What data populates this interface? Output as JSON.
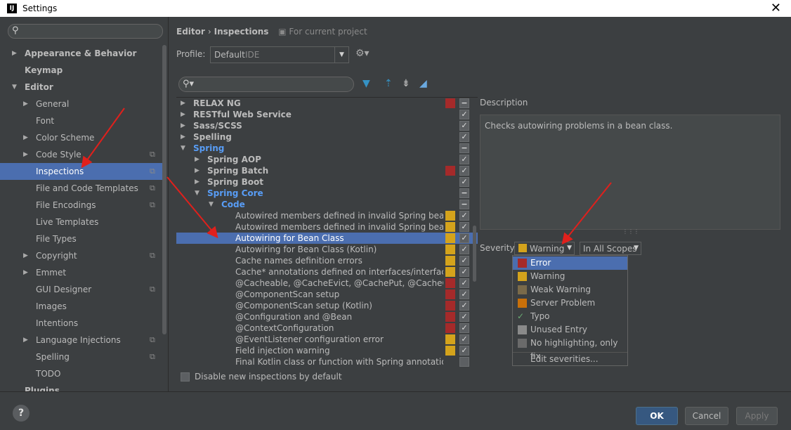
{
  "window": {
    "title": "Settings",
    "logo": "IJ"
  },
  "left_tree": {
    "search_placeholder": "",
    "items": [
      {
        "label": "Appearance & Behavior",
        "bold": true,
        "arrow": "▶",
        "indent": 0
      },
      {
        "label": "Keymap",
        "bold": true,
        "arrow": "",
        "indent": 0
      },
      {
        "label": "Editor",
        "bold": true,
        "arrow": "▼",
        "indent": 0
      },
      {
        "label": "General",
        "arrow": "▶",
        "indent": 1
      },
      {
        "label": "Font",
        "arrow": "",
        "indent": 1
      },
      {
        "label": "Color Scheme",
        "arrow": "▶",
        "indent": 1
      },
      {
        "label": "Code Style",
        "arrow": "▶",
        "indent": 1,
        "copy": true
      },
      {
        "label": "Inspections",
        "arrow": "",
        "indent": 1,
        "copy": true,
        "selected": true
      },
      {
        "label": "File and Code Templates",
        "arrow": "",
        "indent": 1,
        "copy": true
      },
      {
        "label": "File Encodings",
        "arrow": "",
        "indent": 1,
        "copy": true
      },
      {
        "label": "Live Templates",
        "arrow": "",
        "indent": 1
      },
      {
        "label": "File Types",
        "arrow": "",
        "indent": 1
      },
      {
        "label": "Copyright",
        "arrow": "▶",
        "indent": 1,
        "copy": true
      },
      {
        "label": "Emmet",
        "arrow": "▶",
        "indent": 1
      },
      {
        "label": "GUI Designer",
        "arrow": "",
        "indent": 1,
        "copy": true
      },
      {
        "label": "Images",
        "arrow": "",
        "indent": 1
      },
      {
        "label": "Intentions",
        "arrow": "",
        "indent": 1
      },
      {
        "label": "Language Injections",
        "arrow": "▶",
        "indent": 1,
        "copy": true
      },
      {
        "label": "Spelling",
        "arrow": "",
        "indent": 1,
        "copy": true
      },
      {
        "label": "TODO",
        "arrow": "",
        "indent": 1
      },
      {
        "label": "Plugins",
        "bold": true,
        "arrow": "",
        "indent": 0
      }
    ]
  },
  "breadcrumb": {
    "part1": "Editor",
    "separator": "›",
    "part2": "Inspections",
    "scope_note": "For current project"
  },
  "profile": {
    "label": "Profile:",
    "value": "Default",
    "value_suffix": "IDE"
  },
  "inspections": {
    "rows": [
      {
        "label": "RELAX NG",
        "style": "bold",
        "arrow": "▶",
        "indent": 0,
        "sev": "#a52a2a",
        "check": "dash"
      },
      {
        "label": "RESTful Web Service",
        "style": "bold",
        "arrow": "▶",
        "indent": 0,
        "sev": "",
        "check": "yes"
      },
      {
        "label": "Sass/SCSS",
        "style": "bold",
        "arrow": "▶",
        "indent": 0,
        "sev": "",
        "check": "yes"
      },
      {
        "label": "Spelling",
        "style": "bold",
        "arrow": "▶",
        "indent": 0,
        "sev": "",
        "check": "yes"
      },
      {
        "label": "Spring",
        "style": "blue",
        "arrow": "▼",
        "indent": 0,
        "sev": "",
        "check": "dash"
      },
      {
        "label": "Spring AOP",
        "style": "bold",
        "arrow": "▶",
        "indent": 1,
        "sev": "",
        "check": "yes"
      },
      {
        "label": "Spring Batch",
        "style": "bold",
        "arrow": "▶",
        "indent": 1,
        "sev": "#a52a2a",
        "check": "yes"
      },
      {
        "label": "Spring Boot",
        "style": "bold",
        "arrow": "▶",
        "indent": 1,
        "sev": "",
        "check": "yes"
      },
      {
        "label": "Spring Core",
        "style": "blue",
        "arrow": "▼",
        "indent": 1,
        "sev": "",
        "check": "dash"
      },
      {
        "label": "Code",
        "style": "blue",
        "arrow": "▼",
        "indent": 2,
        "sev": "",
        "check": "dash"
      },
      {
        "label": "Autowired members defined in invalid Spring bean",
        "style": "",
        "arrow": "",
        "indent": 3,
        "sev": "#d4a31c",
        "check": "yes"
      },
      {
        "label": "Autowired members defined in invalid Spring bean (Kotlin)",
        "style": "",
        "arrow": "",
        "indent": 3,
        "sev": "#d4a31c",
        "check": "yes"
      },
      {
        "label": "Autowiring for Bean Class",
        "style": "",
        "arrow": "",
        "indent": 3,
        "sev": "#d4a31c",
        "check": "yes",
        "selected": true
      },
      {
        "label": "Autowiring for Bean Class (Kotlin)",
        "style": "",
        "arrow": "",
        "indent": 3,
        "sev": "#d4a31c",
        "check": "yes"
      },
      {
        "label": "Cache names definition errors",
        "style": "",
        "arrow": "",
        "indent": 3,
        "sev": "#d4a31c",
        "check": "yes"
      },
      {
        "label": "Cache* annotations defined on interfaces/interface methods",
        "style": "",
        "arrow": "",
        "indent": 3,
        "sev": "#d4a31c",
        "check": "yes"
      },
      {
        "label": "@Cacheable, @CacheEvict, @CachePut, @CacheConfig",
        "style": "",
        "arrow": "",
        "indent": 3,
        "sev": "#a52a2a",
        "check": "yes"
      },
      {
        "label": "@ComponentScan setup",
        "style": "",
        "arrow": "",
        "indent": 3,
        "sev": "#a52a2a",
        "check": "yes"
      },
      {
        "label": "@ComponentScan setup (Kotlin)",
        "style": "",
        "arrow": "",
        "indent": 3,
        "sev": "#a52a2a",
        "check": "yes"
      },
      {
        "label": "@Configuration and @Bean",
        "style": "",
        "arrow": "",
        "indent": 3,
        "sev": "#a52a2a",
        "check": "yes"
      },
      {
        "label": "@ContextConfiguration",
        "style": "",
        "arrow": "",
        "indent": 3,
        "sev": "#a52a2a",
        "check": "yes"
      },
      {
        "label": "@EventListener configuration error",
        "style": "",
        "arrow": "",
        "indent": 3,
        "sev": "#d4a31c",
        "check": "yes"
      },
      {
        "label": "Field injection warning",
        "style": "",
        "arrow": "",
        "indent": 3,
        "sev": "#d4a31c",
        "check": "yes"
      },
      {
        "label": "Final Kotlin class or function with Spring annotation",
        "style": "",
        "arrow": "",
        "indent": 3,
        "sev": "",
        "check": "partial"
      }
    ]
  },
  "description": {
    "label": "Description",
    "text": "Checks autowiring problems in a bean class."
  },
  "severity": {
    "label": "Severity:",
    "value": "Warning",
    "scope": "In All Scopes",
    "options": [
      {
        "label": "Error",
        "color": "#a52a2a",
        "selected": true
      },
      {
        "label": "Warning",
        "color": "#d4a31c"
      },
      {
        "label": "Weak Warning",
        "color": "#7a6a4a"
      },
      {
        "label": "Server Problem",
        "color": "#c8700a"
      },
      {
        "label": "Typo",
        "color": "",
        "tick": "✓"
      },
      {
        "label": "Unused Entry",
        "color": "#8a8a8a"
      },
      {
        "label": "No highlighting, only fix",
        "color": "#6a6a6a"
      }
    ],
    "edit_label": "Edit severities..."
  },
  "disable_new": {
    "label": "Disable new inspections by default"
  },
  "footer": {
    "help": "?",
    "ok": "OK",
    "cancel": "Cancel",
    "apply": "Apply"
  },
  "colors": {
    "accent": "#4b6eaf",
    "error": "#a52a2a",
    "warning": "#d4a31c",
    "annotation_arrow": "#e0201c"
  }
}
